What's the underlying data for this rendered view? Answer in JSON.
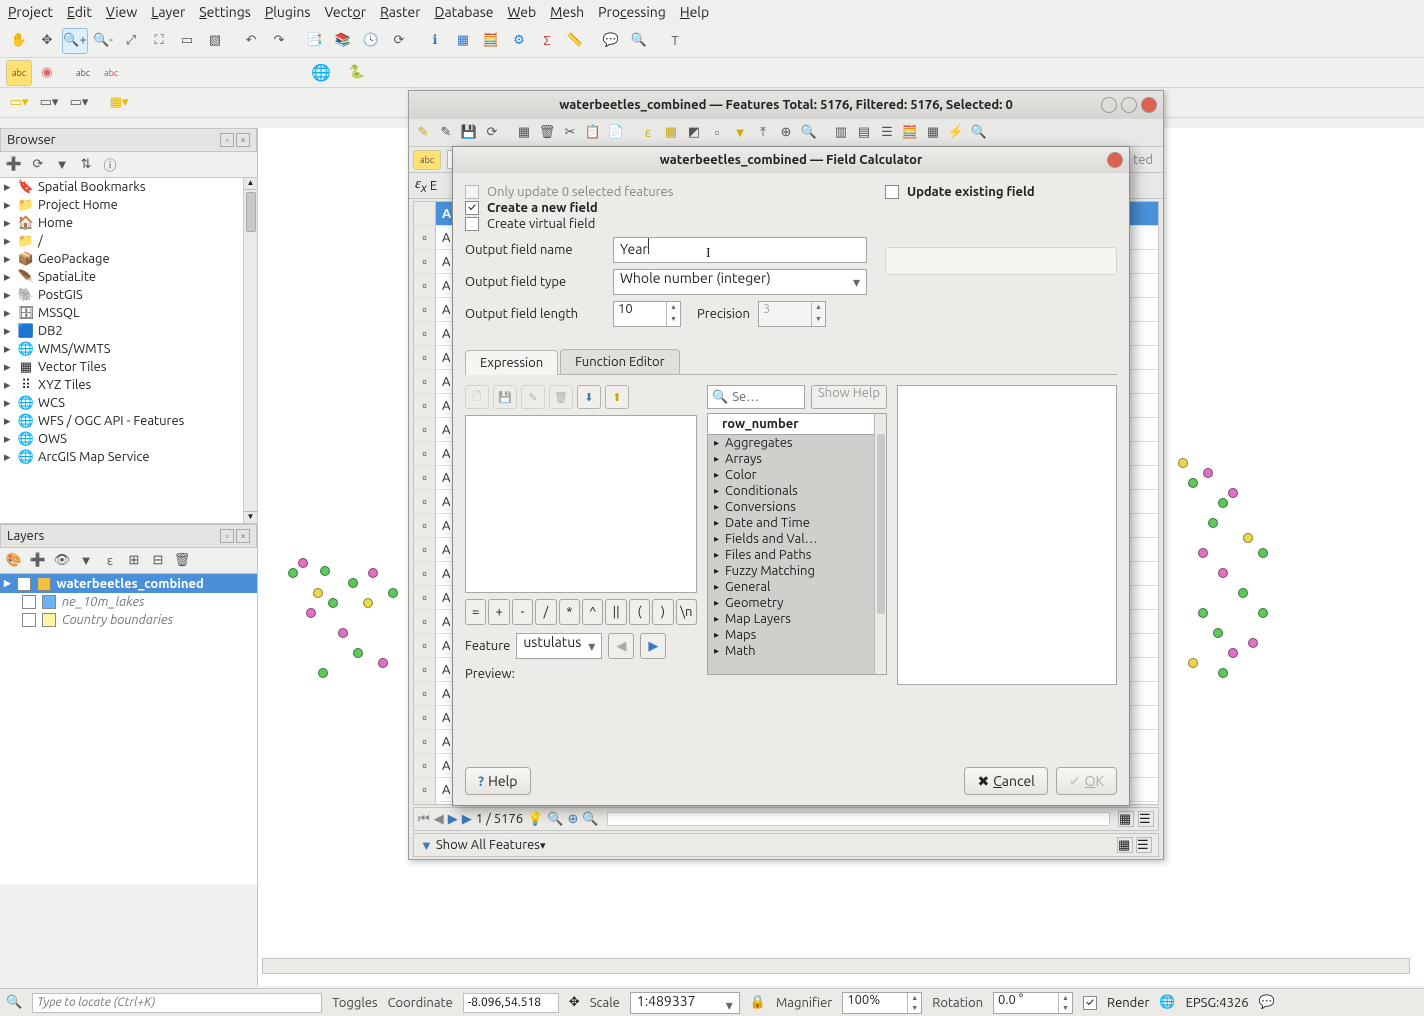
{
  "menu": [
    "Project",
    "Edit",
    "View",
    "Layer",
    "Settings",
    "Plugins",
    "Vector",
    "Raster",
    "Database",
    "Web",
    "Mesh",
    "Processing",
    "Help"
  ],
  "browser": {
    "title": "Browser",
    "items": [
      {
        "label": "Spatial Bookmarks",
        "icon": "bookmark"
      },
      {
        "label": "Project Home",
        "icon": "folder-green"
      },
      {
        "label": "Home",
        "icon": "home"
      },
      {
        "label": "/",
        "icon": "folder"
      },
      {
        "label": "GeoPackage",
        "icon": "gpkg"
      },
      {
        "label": "SpatiaLite",
        "icon": "feather"
      },
      {
        "label": "PostGIS",
        "icon": "elephant"
      },
      {
        "label": "MSSQL",
        "icon": "mssql"
      },
      {
        "label": "DB2",
        "icon": "db2"
      },
      {
        "label": "WMS/WMTS",
        "icon": "globe"
      },
      {
        "label": "Vector Tiles",
        "icon": "grid"
      },
      {
        "label": "XYZ Tiles",
        "icon": "xyz"
      },
      {
        "label": "WCS",
        "icon": "globe"
      },
      {
        "label": "WFS / OGC API - Features",
        "icon": "globe"
      },
      {
        "label": "OWS",
        "icon": "globe"
      },
      {
        "label": "ArcGIS Map Service",
        "icon": "globe"
      }
    ]
  },
  "layers": {
    "title": "Layers",
    "items": [
      {
        "label": "waterbeetles_combined",
        "checked": true,
        "selected": true,
        "color": "#f0c040"
      },
      {
        "label": "ne_10m_lakes",
        "checked": false,
        "selected": false,
        "color": "#6bb0f0",
        "italic": true
      },
      {
        "label": "Country boundaries",
        "checked": false,
        "selected": false,
        "color": "#fff6a0",
        "italic": true
      }
    ]
  },
  "attr_table": {
    "title": "waterbeetles_combined — Features Total: 5176, Filtered: 5176, Selected: 0",
    "nav_text": "1 / 5176",
    "footer": "Show All Features",
    "row_letter": "A"
  },
  "field_calc": {
    "title": "waterbeetles_combined — Field Calculator",
    "only_update": "Only update 0 selected features",
    "create_new": "Create a new field",
    "create_virtual": "Create virtual field",
    "update_existing": "Update existing field",
    "out_name_label": "Output field name",
    "out_name_value": "Year",
    "out_type_label": "Output field type",
    "out_type_value": "Whole number (integer)",
    "out_len_label": "Output field length",
    "out_len_value": "10",
    "precision_label": "Precision",
    "precision_value": "3",
    "tabs": [
      "Expression",
      "Function Editor"
    ],
    "ops": [
      "=",
      "+",
      "-",
      "/",
      "*",
      "^",
      "||",
      "(",
      ")",
      "\\n"
    ],
    "feature_label": "Feature",
    "feature_value": "ustulatus",
    "preview": "Preview:",
    "search_placeholder": "Se…",
    "show_help": "Show Help",
    "func_head": "row_number",
    "func_groups": [
      "Aggregates",
      "Arrays",
      "Color",
      "Conditionals",
      "Conversions",
      "Date and Time",
      "Fields and Val…",
      "Files and Paths",
      "Fuzzy Matching",
      "General",
      "Geometry",
      "Map Layers",
      "Maps",
      "Math"
    ],
    "help": "Help",
    "cancel": "Cancel",
    "ok": "OK"
  },
  "status": {
    "locator_placeholder": "Type to locate (Ctrl+K)",
    "toggles": "Toggles",
    "coord_label": "Coordinate",
    "coord": "-8.096,54.518",
    "scale_label": "Scale",
    "scale": "1:489337",
    "magnifier_label": "Magnifier",
    "magnifier": "100%",
    "rotation_label": "Rotation",
    "rotation": "0.0 °",
    "render": "Render",
    "crs": "EPSG:4326"
  }
}
